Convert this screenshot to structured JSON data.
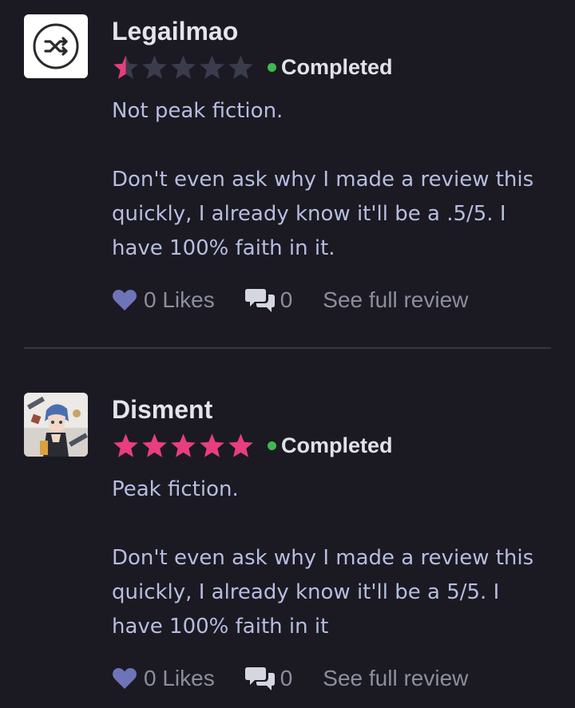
{
  "reviews": [
    {
      "username": "Legailmao",
      "avatar_icon": "shuffle-icon",
      "rating": 0.5,
      "status": "Completed",
      "body": [
        "Not peak fiction.",
        "",
        "Don't even ask why I made a review this",
        "quickly, I already know it'll be a .5/5. I",
        "have 100% faith in it."
      ],
      "likes_label": "0 Likes",
      "comments_count": "0",
      "see_full_label": "See full review"
    },
    {
      "username": "Disment",
      "avatar_icon": "anime-character-avatar",
      "rating": 5,
      "status": "Completed",
      "body": [
        "Peak fiction.",
        "",
        "Don't even ask why I made a review this",
        "quickly, I already know it'll be a 5/5. I",
        "have 100% faith in it"
      ],
      "likes_label": "0 Likes",
      "comments_count": "0",
      "see_full_label": "See full review"
    }
  ],
  "colors": {
    "background": "#1b1a22",
    "star_filled": "#e83e7e",
    "star_empty": "#3a3b4d",
    "status_dot": "#3fb950",
    "heart": "#6d74b8",
    "comment_icon": "#d4d6e0",
    "divider": "#363642"
  }
}
